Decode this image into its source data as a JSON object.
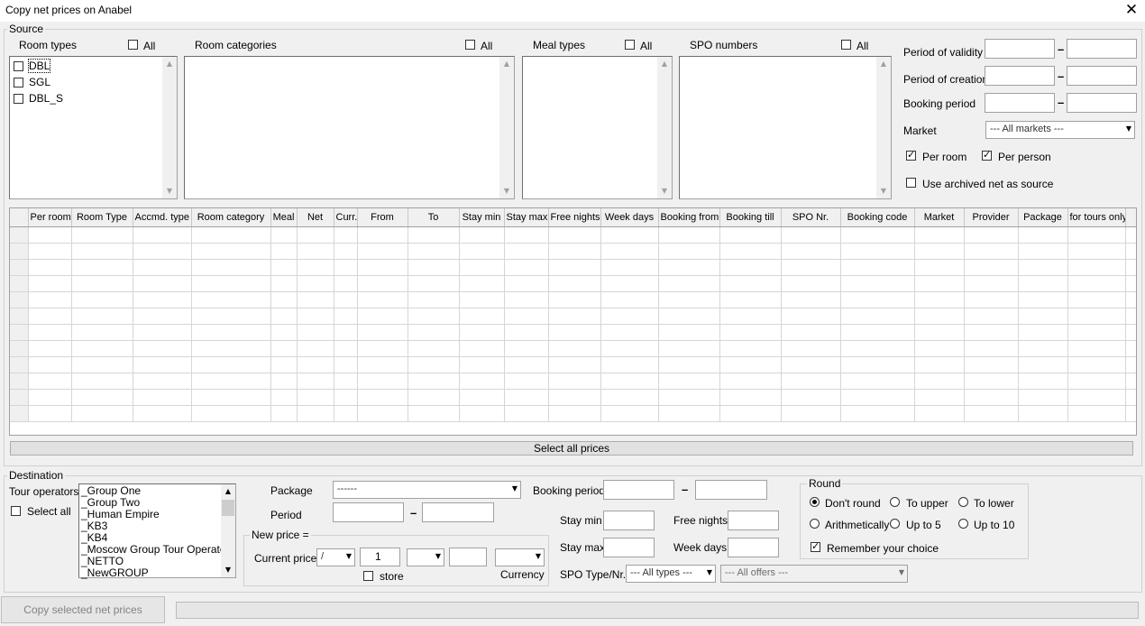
{
  "window": {
    "title": "Copy net prices on Anabel",
    "close_glyph": "✕"
  },
  "source": {
    "legend": "Source",
    "room_types": {
      "label": "Room types",
      "all_label": "All",
      "items": [
        "DBL",
        "SGL",
        "DBL_S"
      ]
    },
    "room_categories": {
      "label": "Room categories",
      "all_label": "All"
    },
    "meal_types": {
      "label": "Meal types",
      "all_label": "All"
    },
    "spo_numbers": {
      "label": "SPO numbers",
      "all_label": "All"
    },
    "period_of_validity": "Period of validity",
    "period_of_creation": "Period of creation",
    "booking_period": "Booking period",
    "market": {
      "label": "Market",
      "value": "--- All markets ---"
    },
    "per_room": "Per room",
    "per_person": "Per person",
    "use_archived": "Use archived net as source",
    "dash": "–"
  },
  "grid": {
    "columns": [
      "Per room",
      "Room Type",
      "Accmd. type",
      "Room category",
      "Meal",
      "Net",
      "Curr.",
      "From",
      "To",
      "Stay min",
      "Stay max",
      "Free nights",
      "Week days",
      "Booking from",
      "Booking till",
      "SPO Nr.",
      "Booking code",
      "Market",
      "Provider",
      "Package",
      "for tours only",
      ""
    ],
    "select_all_label": "Select all prices"
  },
  "destination": {
    "legend": "Destination",
    "tour_operators_label": "Tour operators",
    "select_all_label": "Select all",
    "tour_operators": [
      "_Group One",
      "_Group Two",
      "_Human Empire",
      "_KB3",
      "_KB4",
      "_Moscow Group Tour Operator",
      "_NETTO",
      "_NewGROUP"
    ],
    "package_label": "Package",
    "package_value": "------",
    "period_label": "Period",
    "new_price_legend": "New price =",
    "current_price_label": "Current price",
    "operator_value": "/",
    "factor_value": "1",
    "store_label": "store",
    "currency_label": "Currency",
    "booking_period_label": "Booking period",
    "stay_min_label": "Stay min",
    "stay_max_label": "Stay max",
    "free_nights_label": "Free nights",
    "week_days_label": "Week days",
    "spo_type_label": "SPO Type/Nr.",
    "spo_type_value": "--- All types ---",
    "offers_value": "--- All offers ---",
    "round": {
      "legend": "Round",
      "dont_round": "Don't round",
      "to_upper": "To upper",
      "to_lower": "To lower",
      "arithmetically": "Arithmetically",
      "up_to_5": "Up to 5",
      "up_to_10": "Up to 10",
      "remember": "Remember your choice"
    }
  },
  "footer": {
    "copy_button": "Copy selected net prices"
  }
}
